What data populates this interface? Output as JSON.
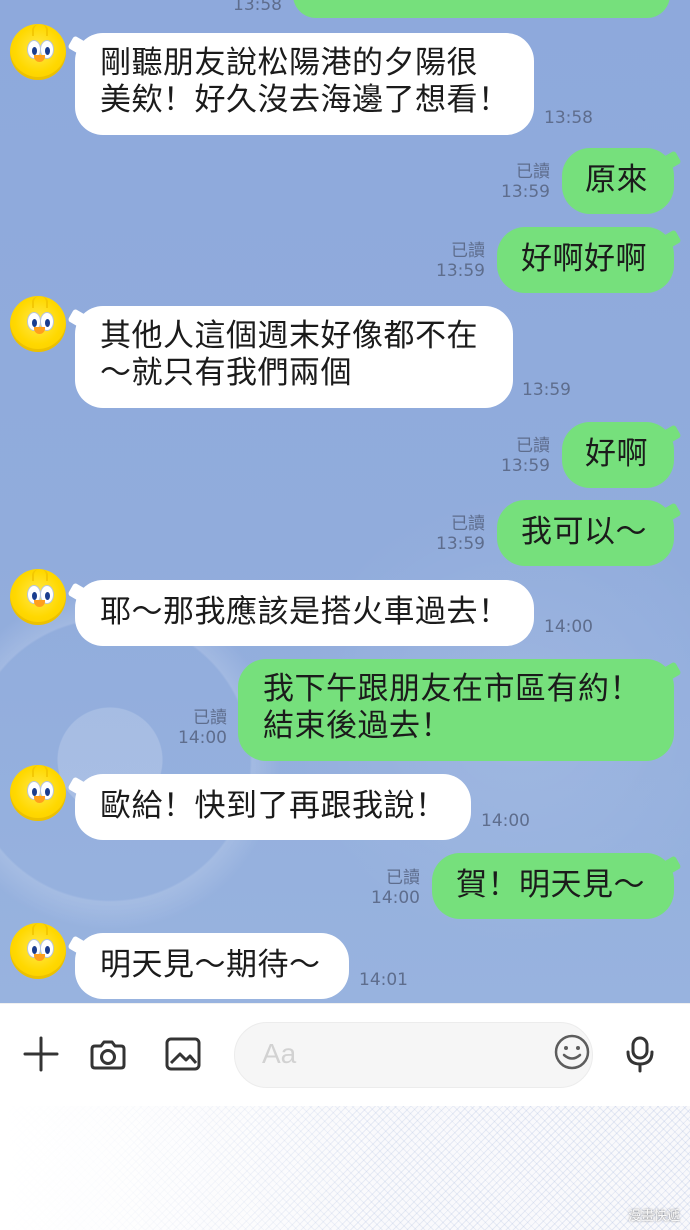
{
  "chat": {
    "top_cut_time": "13:58",
    "messages": [
      {
        "side": "left",
        "text": "剛聽朋友說松陽港的夕陽很\n美欸！好久沒去海邊了想看！",
        "time": "13:58"
      },
      {
        "side": "right",
        "text": "原來",
        "read": "已讀",
        "time": "13:59"
      },
      {
        "side": "right",
        "text": "好啊好啊",
        "read": "已讀",
        "time": "13:59"
      },
      {
        "side": "left",
        "text": "其他人這個週末好像都不在\n～就只有我們兩個",
        "time": "13:59"
      },
      {
        "side": "right",
        "text": "好啊",
        "read": "已讀",
        "time": "13:59"
      },
      {
        "side": "right",
        "text": "我可以～",
        "read": "已讀",
        "time": "13:59"
      },
      {
        "side": "left",
        "text": "耶～那我應該是搭火車過去！",
        "time": "14:00"
      },
      {
        "side": "right",
        "text": "我下午跟朋友在市區有約！\n結束後過去！",
        "read": "已讀",
        "time": "14:00"
      },
      {
        "side": "left",
        "text": "歐給！快到了再跟我說！",
        "time": "14:00"
      },
      {
        "side": "right",
        "text": "賀！明天見～",
        "read": "已讀",
        "time": "14:00"
      },
      {
        "side": "left",
        "text": "明天見～期待～",
        "time": "14:01"
      }
    ]
  },
  "composer": {
    "placeholder": "Aa",
    "icons": {
      "add": "plus-icon",
      "camera": "camera-icon",
      "image": "image-icon",
      "emoji": "emoji-icon",
      "mic": "microphone-icon"
    }
  },
  "footer": {
    "watermark": "漫畫快遞"
  },
  "colors": {
    "chat_bg": "#91acdc",
    "left_bubble": "#ffffff",
    "right_bubble": "#76e07c",
    "meta_text": "#5e6d8d"
  }
}
